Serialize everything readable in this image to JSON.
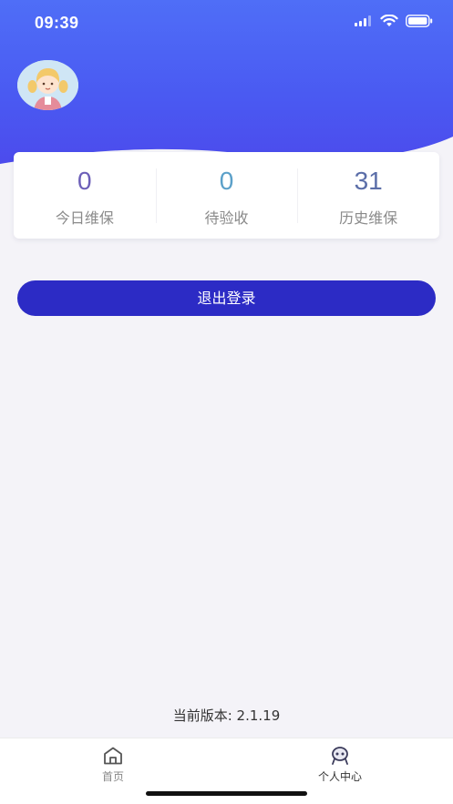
{
  "status_bar": {
    "time": "09:39"
  },
  "stats": [
    {
      "value": "0",
      "label": "今日维保",
      "color": "#6c5fb8"
    },
    {
      "value": "0",
      "label": "待验收",
      "color": "#5ba0c9"
    },
    {
      "value": "31",
      "label": "历史维保",
      "color": "#5b6ea8"
    }
  ],
  "actions": {
    "logout_label": "退出登录"
  },
  "footer": {
    "version_text": "当前版本: 2.1.19"
  },
  "tabbar": {
    "items": [
      {
        "label": "首页",
        "icon": "home-icon",
        "active": false
      },
      {
        "label": "个人中心",
        "icon": "profile-icon",
        "active": true
      }
    ]
  },
  "colors": {
    "header_gradient_top": "#4f6ef7",
    "header_gradient_bottom": "#4c49ec",
    "button": "#2c2bc5",
    "background": "#f4f3f8"
  }
}
